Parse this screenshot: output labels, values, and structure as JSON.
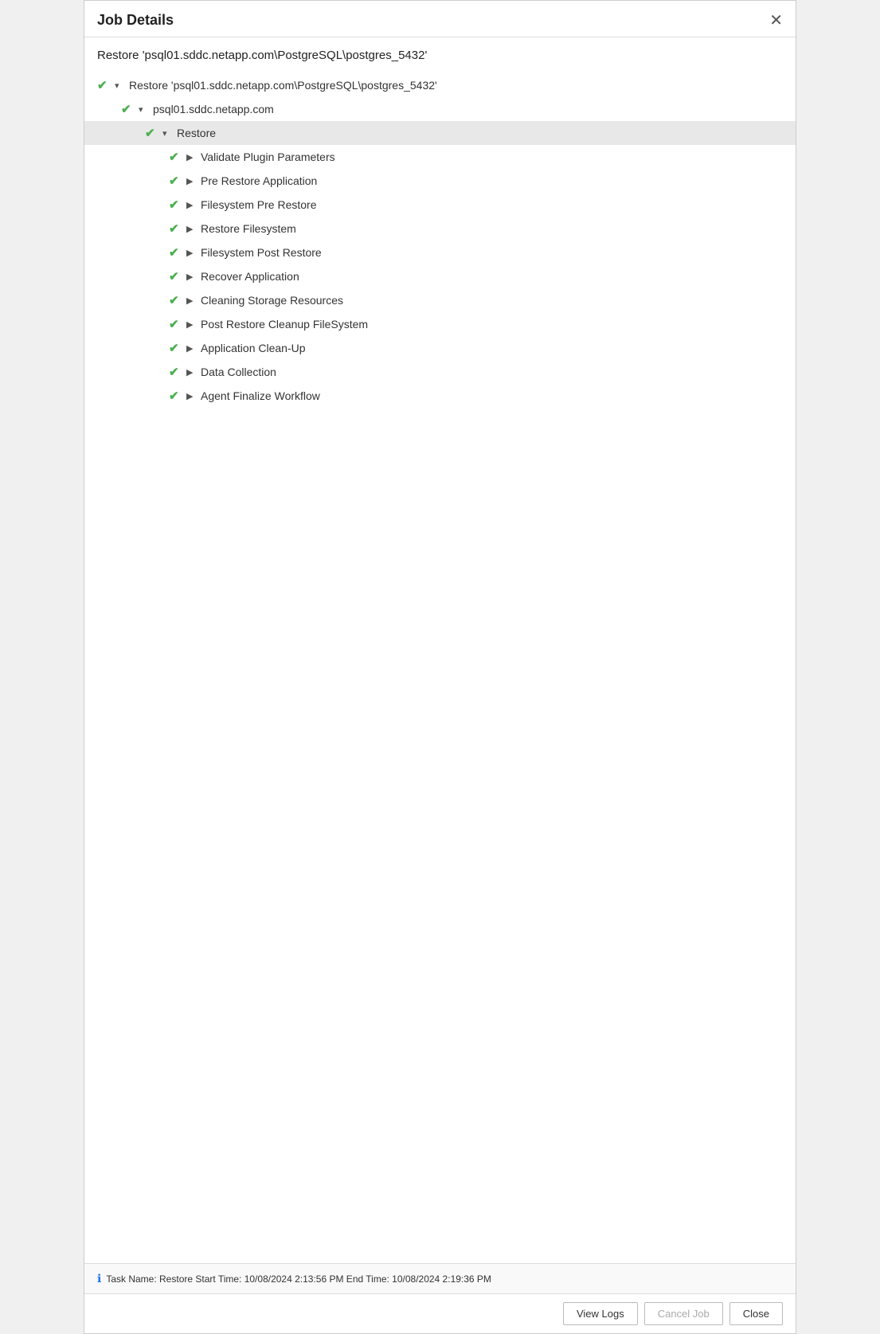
{
  "dialog": {
    "title": "Job Details",
    "close_label": "✕"
  },
  "job": {
    "title": "Restore 'psql01.sddc.netapp.com\\PostgreSQL\\postgres_5432'",
    "tree": [
      {
        "id": "root",
        "level": 0,
        "check": "✔",
        "arrow": "▾",
        "label": "Restore 'psql01.sddc.netapp.com\\PostgreSQL\\postgres_5432'",
        "highlighted": false
      },
      {
        "id": "host",
        "level": 1,
        "check": "✔",
        "arrow": "▾",
        "label": "psql01.sddc.netapp.com",
        "highlighted": false
      },
      {
        "id": "restore",
        "level": 2,
        "check": "✔",
        "arrow": "▾",
        "label": "Restore",
        "highlighted": true
      },
      {
        "id": "validate-plugin",
        "level": 3,
        "check": "✔",
        "arrow": "▶",
        "label": "Validate Plugin Parameters",
        "highlighted": false
      },
      {
        "id": "pre-restore-app",
        "level": 3,
        "check": "✔",
        "arrow": "▶",
        "label": "Pre Restore Application",
        "highlighted": false
      },
      {
        "id": "filesystem-pre-restore",
        "level": 3,
        "check": "✔",
        "arrow": "▶",
        "label": "Filesystem Pre Restore",
        "highlighted": false
      },
      {
        "id": "restore-filesystem",
        "level": 3,
        "check": "✔",
        "arrow": "▶",
        "label": "Restore Filesystem",
        "highlighted": false
      },
      {
        "id": "filesystem-post-restore",
        "level": 3,
        "check": "✔",
        "arrow": "▶",
        "label": "Filesystem Post Restore",
        "highlighted": false
      },
      {
        "id": "recover-application",
        "level": 3,
        "check": "✔",
        "arrow": "▶",
        "label": "Recover Application",
        "highlighted": false
      },
      {
        "id": "cleaning-storage",
        "level": 3,
        "check": "✔",
        "arrow": "▶",
        "label": "Cleaning Storage Resources",
        "highlighted": false
      },
      {
        "id": "post-restore-cleanup",
        "level": 3,
        "check": "✔",
        "arrow": "▶",
        "label": "Post Restore Cleanup FileSystem",
        "highlighted": false
      },
      {
        "id": "app-cleanup",
        "level": 3,
        "check": "✔",
        "arrow": "▶",
        "label": "Application Clean-Up",
        "highlighted": false
      },
      {
        "id": "data-collection",
        "level": 3,
        "check": "✔",
        "arrow": "▶",
        "label": "Data Collection",
        "highlighted": false
      },
      {
        "id": "agent-finalize",
        "level": 3,
        "check": "✔",
        "arrow": "▶",
        "label": "Agent Finalize Workflow",
        "highlighted": false
      }
    ]
  },
  "footer": {
    "info_text": "Task Name: Restore Start Time: 10/08/2024 2:13:56 PM End Time: 10/08/2024 2:19:36 PM"
  },
  "buttons": {
    "view_logs": "View Logs",
    "cancel_job": "Cancel Job",
    "close": "Close"
  }
}
